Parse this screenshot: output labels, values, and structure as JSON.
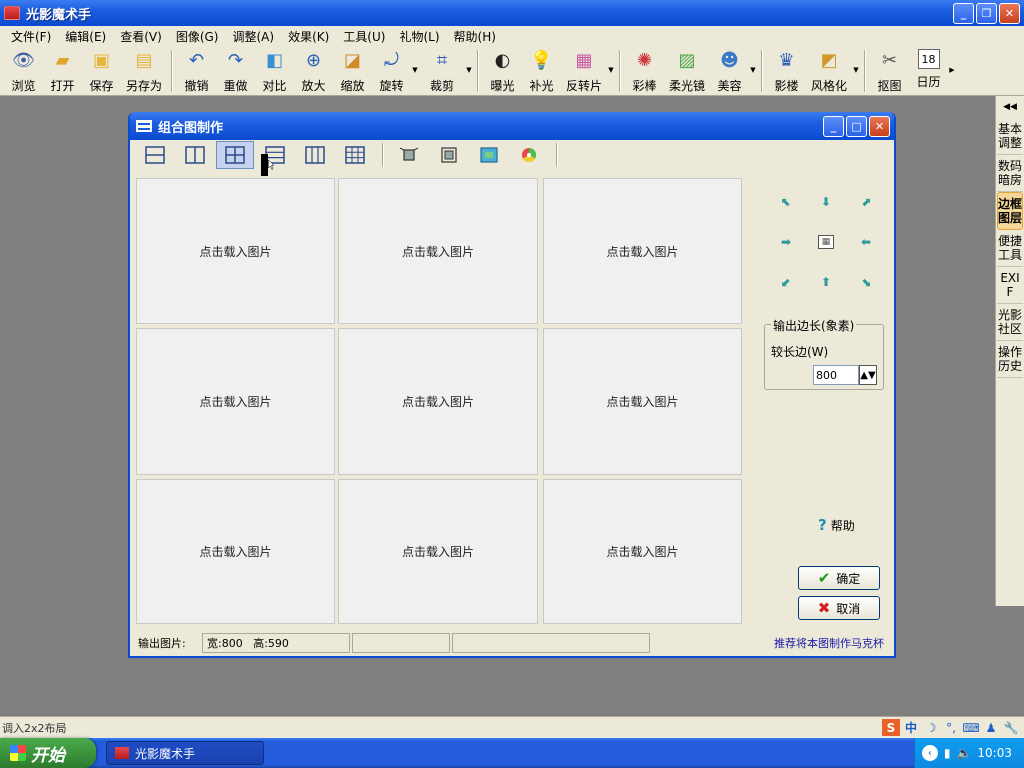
{
  "window": {
    "title": "光影魔术手",
    "controls": [
      "minimize",
      "restore",
      "close"
    ]
  },
  "menu": [
    "文件(F)",
    "编辑(E)",
    "查看(V)",
    "图像(G)",
    "调整(A)",
    "效果(K)",
    "工具(U)",
    "礼物(L)",
    "帮助(H)"
  ],
  "toolbar": [
    {
      "label": "浏览",
      "icon": "eye-icon"
    },
    {
      "label": "打开",
      "icon": "folder-icon"
    },
    {
      "label": "保存",
      "icon": "save-icon"
    },
    {
      "label": "另存为",
      "icon": "save-as-icon"
    },
    {
      "label": "撤销",
      "icon": "undo-icon"
    },
    {
      "label": "重做",
      "icon": "redo-icon"
    },
    {
      "label": "对比",
      "icon": "compare-icon"
    },
    {
      "label": "放大",
      "icon": "zoom-in-icon"
    },
    {
      "label": "缩放",
      "icon": "resize-icon"
    },
    {
      "label": "旋转",
      "icon": "rotate-icon"
    },
    {
      "label": "裁剪",
      "icon": "crop-icon"
    },
    {
      "label": "曝光",
      "icon": "exposure-icon"
    },
    {
      "label": "补光",
      "icon": "fill-light-icon"
    },
    {
      "label": "反转片",
      "icon": "reversal-film-icon"
    },
    {
      "label": "彩棒",
      "icon": "color-wand-icon"
    },
    {
      "label": "柔光镜",
      "icon": "soft-light-icon"
    },
    {
      "label": "美容",
      "icon": "beauty-icon"
    },
    {
      "label": "影楼",
      "icon": "studio-icon"
    },
    {
      "label": "风格化",
      "icon": "stylize-icon"
    },
    {
      "label": "抠图",
      "icon": "cutout-icon"
    },
    {
      "label": "日历",
      "icon": "calendar-icon",
      "badge": "18"
    }
  ],
  "right_panel": {
    "tabs": [
      {
        "label": "基本调整",
        "active": false
      },
      {
        "label": "数码暗房",
        "active": false
      },
      {
        "label": "边框图层",
        "active": true
      },
      {
        "label": "便捷工具",
        "active": false
      },
      {
        "label": "EXIF",
        "active": false
      },
      {
        "label": "光影社区",
        "active": false
      },
      {
        "label": "操作历史",
        "active": false
      }
    ]
  },
  "dialog": {
    "title": "组合图制作",
    "cells": [
      "点击载入图片",
      "点击载入图片",
      "点击载入图片",
      "点击载入图片",
      "点击载入图片",
      "点击载入图片",
      "点击载入图片",
      "点击载入图片",
      "点击载入图片"
    ],
    "output": {
      "legend": "输出边长(象素)",
      "label": "较长边(W)",
      "value": "800"
    },
    "help_label": "帮助",
    "ok_label": "确定",
    "cancel_label": "取消",
    "status": {
      "output_label": "输出图片:",
      "width_label": "宽:800",
      "height_label": "高:590",
      "recommend_link": "推荐将本图制作马克杯"
    }
  },
  "statusbar": {
    "text": "调入2x2布局"
  },
  "taskbar": {
    "start_label": "开始",
    "task_label": "光影魔术手",
    "clock": "10:03"
  }
}
